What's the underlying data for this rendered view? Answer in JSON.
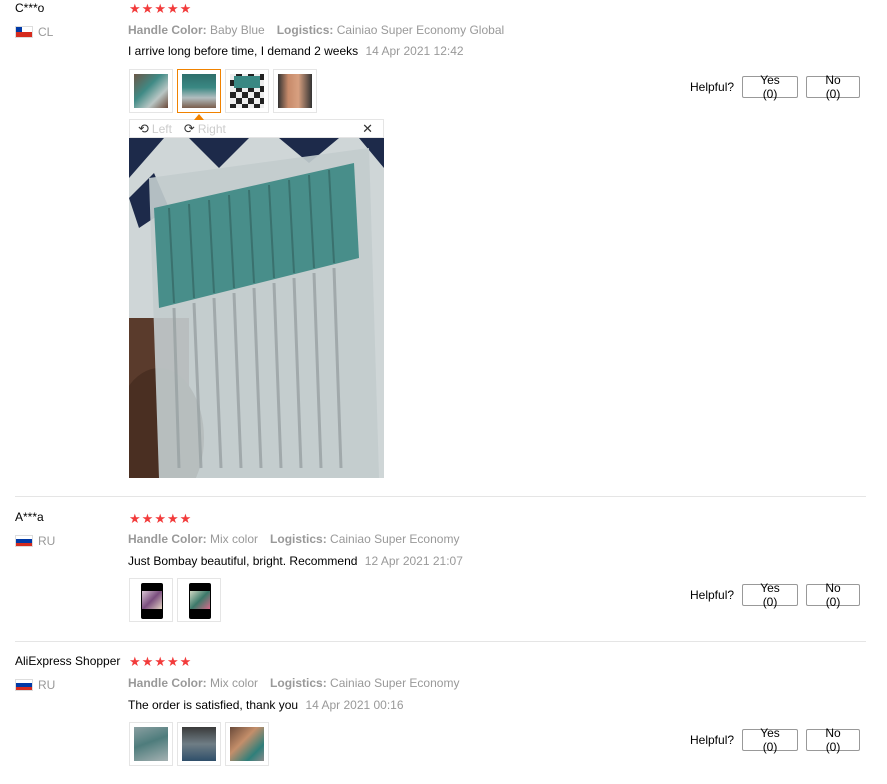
{
  "reviews": [
    {
      "user": "C***o",
      "country": "CL",
      "rating": 5,
      "attr1_label": "Handle Color:",
      "attr1_value": "Baby Blue",
      "attr2_label": "Logistics:",
      "attr2_value": "Cainiao Super Economy Global",
      "comment": "I arrive long before time, I demand 2 weeks",
      "date": "14 Apr 2021 12:42",
      "helpful_label": "Helpful?",
      "yes_label": "Yes (0)",
      "no_label": "No (0)",
      "photo_count": 4
    },
    {
      "user": "A***a",
      "country": "RU",
      "rating": 5,
      "attr1_label": "Handle Color:",
      "attr1_value": "Mix color",
      "attr2_label": "Logistics:",
      "attr2_value": "Cainiao Super Economy",
      "comment": "Just Bombay beautiful, bright. Recommend",
      "date": "12 Apr 2021 21:07",
      "helpful_label": "Helpful?",
      "yes_label": "Yes (0)",
      "no_label": "No (0)",
      "photo_count": 2
    },
    {
      "user": "AliExpress Shopper",
      "country": "RU",
      "rating": 5,
      "attr1_label": "Handle Color:",
      "attr1_value": "Mix color",
      "attr2_label": "Logistics:",
      "attr2_value": "Cainiao Super Economy",
      "comment": "The order is satisfied, thank you",
      "date": "14 Apr 2021 00:16",
      "helpful_label": "Helpful?",
      "yes_label": "Yes (0)",
      "no_label": "No (0)",
      "photo_count": 3
    }
  ],
  "viewer": {
    "left_label": "Left",
    "right_label": "Right",
    "left_icon": "rotate-left-icon",
    "right_icon": "rotate-right-icon",
    "close_icon": "close-icon",
    "active_photo": 2
  },
  "colors": {
    "star": "#f23b3b",
    "active_thumb_border": "#f08200",
    "muted_text": "#999999"
  }
}
